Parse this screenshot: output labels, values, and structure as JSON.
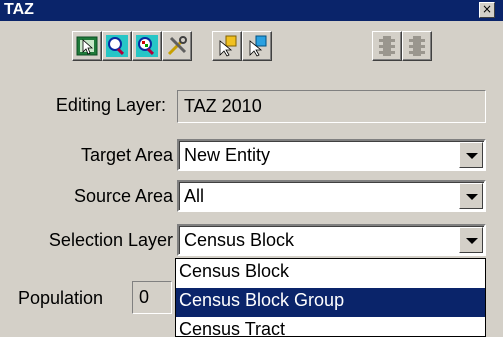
{
  "window": {
    "title": "TAZ",
    "close_glyph": "×"
  },
  "toolbar": {
    "icons": [
      "select-arrow-icon",
      "zoom-in-icon",
      "zoom-to-selection-icon",
      "tools-icon",
      "pointer-select-icon",
      "pointer-flag-icon",
      "disabled-traffic-light-icon",
      "disabled-traffic-light-icon"
    ]
  },
  "form": {
    "editing_layer": {
      "label": "Editing Layer:",
      "value": "TAZ 2010"
    },
    "target_area": {
      "label": "Target Area",
      "value": "New Entity"
    },
    "source_area": {
      "label": "Source Area",
      "value": "All"
    },
    "selection_layer": {
      "label": "Selection Layer",
      "value": "Census Block"
    },
    "population": {
      "label": "Population",
      "value": "0"
    }
  },
  "dropdown": {
    "options": [
      "Census Block",
      "Census Block Group",
      "Census Tract"
    ],
    "selected_index": 1
  },
  "colors": {
    "titlebar": "#0a246a",
    "highlight": "#0a246a",
    "window_bg": "#d4d0c8"
  }
}
